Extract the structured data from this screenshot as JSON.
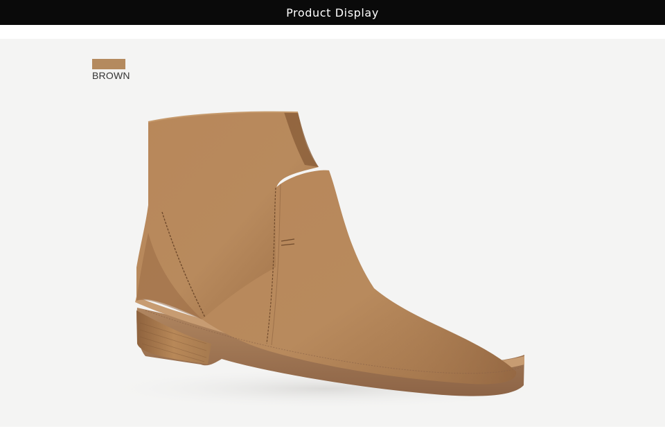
{
  "header": {
    "title": "Product Display"
  },
  "color_option": {
    "label": "BROWN",
    "swatch_color": "#b48a5e"
  },
  "colors": {
    "header_bg": "#0a0a0a",
    "panel_bg": "#f4f4f3",
    "leather": "#b8875a",
    "sole": "#a07656"
  }
}
